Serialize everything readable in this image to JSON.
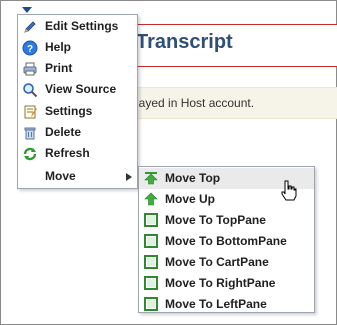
{
  "page": {
    "title": "Transcript",
    "info_message": "layed in Host account."
  },
  "menu": {
    "items": [
      {
        "label": "Edit Settings",
        "icon": "pencil-icon"
      },
      {
        "label": "Help",
        "icon": "help-icon"
      },
      {
        "label": "Print",
        "icon": "printer-icon"
      },
      {
        "label": "View Source",
        "icon": "magnifier-icon"
      },
      {
        "label": "Settings",
        "icon": "settings-icon"
      },
      {
        "label": "Delete",
        "icon": "trash-icon"
      },
      {
        "label": "Refresh",
        "icon": "refresh-icon"
      },
      {
        "label": "Move",
        "icon": "submenu-arrow-icon"
      }
    ]
  },
  "submenu": {
    "items": [
      {
        "label": "Move Top",
        "icon": "arrow-top-icon"
      },
      {
        "label": "Move Up",
        "icon": "arrow-up-icon"
      },
      {
        "label": "Move To TopPane",
        "icon": "pane-icon"
      },
      {
        "label": "Move To BottomPane",
        "icon": "pane-icon"
      },
      {
        "label": "Move To CartPane",
        "icon": "pane-icon"
      },
      {
        "label": "Move To RightPane",
        "icon": "pane-icon"
      },
      {
        "label": "Move To LeftPane",
        "icon": "pane-icon"
      }
    ]
  },
  "colors": {
    "title": "#2f4f77",
    "title_border": "#c62b2b",
    "info_bg": "#f6f3e8",
    "menu_border": "#9da4ad",
    "pane_icon_green": "#3a9a3a"
  }
}
